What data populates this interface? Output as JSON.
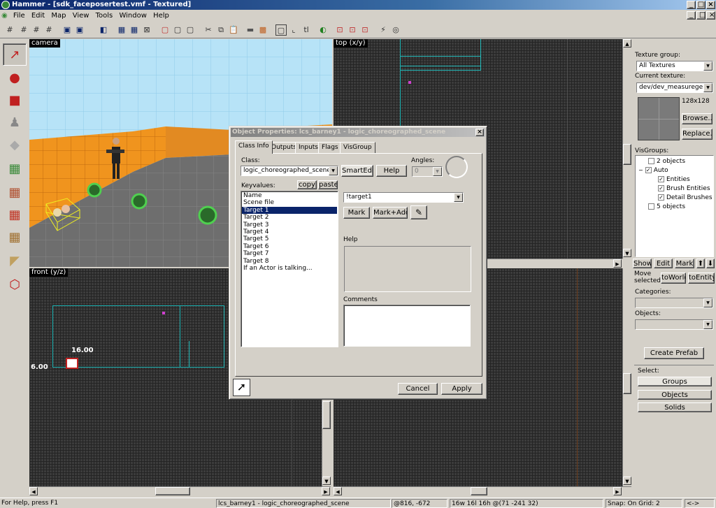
{
  "window": {
    "title": "Hammer - [sdk_faceposertest.vmf - Textured]",
    "controls": [
      "_",
      "□",
      "×"
    ]
  },
  "menu": [
    "File",
    "Edit",
    "Map",
    "View",
    "Tools",
    "Window",
    "Help"
  ],
  "viewports": {
    "camera": "camera",
    "top": "top (x/y)",
    "front": "front (y/z)",
    "front_dim_h": "16.00",
    "front_dim_v": "6.00"
  },
  "right_panel": {
    "texture_group_label": "Texture group:",
    "texture_group_value": "All Textures",
    "current_texture_label": "Current texture:",
    "current_texture_value": "dev/dev_measuregene",
    "texture_size": "128x128",
    "browse": "Browse...",
    "replace": "Replace...",
    "visgroups_label": "VisGroups:",
    "visgroups": [
      {
        "label": "2 objects",
        "checked": false,
        "indent": 0
      },
      {
        "label": "Auto",
        "checked": true,
        "indent": 0,
        "expander": "−"
      },
      {
        "label": "Entities",
        "checked": true,
        "indent": 1
      },
      {
        "label": "Brush Entities",
        "checked": true,
        "indent": 1
      },
      {
        "label": "Detail Brushes",
        "checked": true,
        "indent": 1
      },
      {
        "label": "5 objects",
        "checked": false,
        "indent": 0
      }
    ],
    "show": "Show",
    "edit": "Edit",
    "mark": "Mark",
    "move_selected": "Move selected:",
    "to_world": "toWorld",
    "to_entity": "toEntity",
    "categories_label": "Categories:",
    "objects_label": "Objects:",
    "create_prefab": "Create Prefab",
    "select_label": "Select:",
    "groups": "Groups",
    "objects": "Objects",
    "solids": "Solids"
  },
  "dialog": {
    "title": "Object Properties: lcs_barney1 - logic_choreographed_scene",
    "tabs": [
      "Class Info",
      "Outputs",
      "Inputs",
      "Flags",
      "VisGroup"
    ],
    "class_label": "Class:",
    "class_value": "logic_choreographed_scene",
    "smartedit": "SmartEdit",
    "help_button": "Help",
    "angles_label": "Angles:",
    "angles_value": "0",
    "keyvalues_label": "Keyvalues:",
    "copy": "copy",
    "paste": "paste",
    "keyvalues": [
      "Name",
      "Scene file",
      "Target 1",
      "Target 2",
      "Target 3",
      "Target 4",
      "Target 5",
      "Target 6",
      "Target 7",
      "Target 8",
      "If an Actor is talking..."
    ],
    "selected_index": 2,
    "value_field": "!target1",
    "mark": "Mark",
    "mark_add": "Mark+Add",
    "help_label": "Help",
    "comments_label": "Comments",
    "cancel": "Cancel",
    "apply": "Apply"
  },
  "status": {
    "help": "For Help, press F1",
    "selection": "lcs_barney1 - logic_choreographed_scene",
    "coords": "@816, -672",
    "size": "16w 16l 16h @(71 -241 32)",
    "snap": "Snap: On Grid: 2",
    "extra": "<->"
  }
}
